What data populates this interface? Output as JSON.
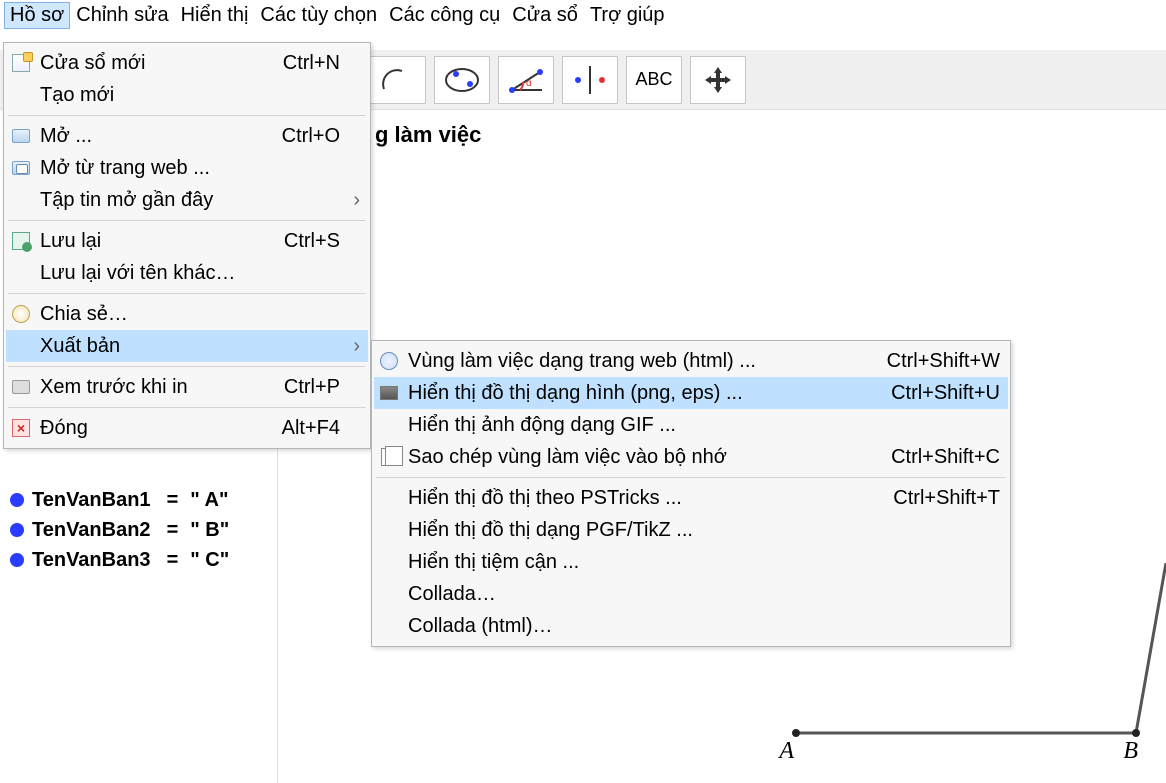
{
  "menubar": {
    "file": "Hồ sơ",
    "edit": "Chỉnh sửa",
    "view": "Hiển thị",
    "options": "Các tùy chọn",
    "tools": "Các công cụ",
    "window": "Cửa sổ",
    "help": "Trợ giúp"
  },
  "section_title_fragment": "g làm việc",
  "file_menu": {
    "new_window": "Cửa sổ mới",
    "new_window_accel": "Ctrl+N",
    "new": "Tạo mới",
    "open": "Mở ...",
    "open_accel": "Ctrl+O",
    "open_web": "Mở từ trang web ...",
    "recent": "Tập tin mở gần đây",
    "save": "Lưu lại",
    "save_accel": "Ctrl+S",
    "save_as": "Lưu lại với tên khác…",
    "share": "Chia sẻ…",
    "export": "Xuất bản",
    "print_preview": "Xem trước khi in",
    "print_preview_accel": "Ctrl+P",
    "close": "Đóng",
    "close_accel": "Alt+F4"
  },
  "export_menu": {
    "html": "Vùng làm việc dạng trang web (html) ...",
    "html_accel": "Ctrl+Shift+W",
    "png": "Hiển thị đồ thị dạng hình (png, eps) ...",
    "png_accel": "Ctrl+Shift+U",
    "gif": "Hiển thị ảnh động dạng GIF ...",
    "copy": "Sao chép vùng làm việc vào bộ nhớ",
    "copy_accel": "Ctrl+Shift+C",
    "pstricks": "Hiển thị đồ thị theo PSTricks ...",
    "pstricks_accel": "Ctrl+Shift+T",
    "tikz": "Hiển thị đồ thị dạng PGF/TikZ ...",
    "asymptote": "Hiển thị tiệm cận ...",
    "collada": "Collada…",
    "collada_html": "Collada (html)…"
  },
  "algebra": {
    "rows": [
      {
        "name": "TenVanBan1",
        "eq": "=",
        "val": "\" A\""
      },
      {
        "name": "TenVanBan2",
        "eq": "=",
        "val": "\" B\""
      },
      {
        "name": "TenVanBan3",
        "eq": "=",
        "val": "\" C\""
      }
    ]
  },
  "points": {
    "A": "A",
    "B": "B"
  }
}
